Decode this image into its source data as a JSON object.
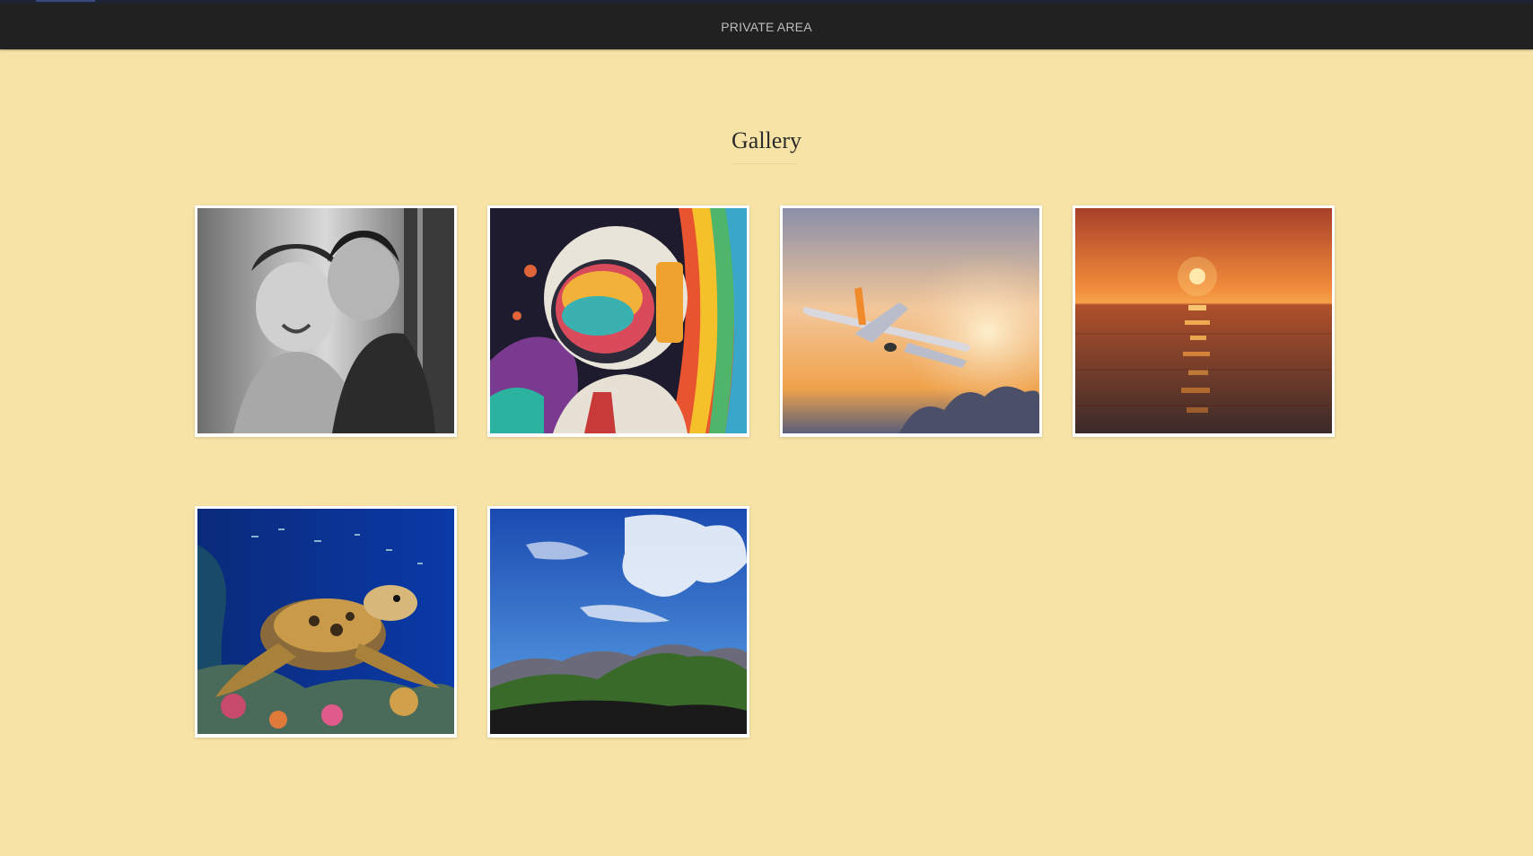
{
  "navbar": {
    "brand": "PRIVATE AREA"
  },
  "gallery": {
    "title": "Gallery",
    "items": [
      {
        "icon": "photo-children-bw"
      },
      {
        "icon": "photo-astronaut-art"
      },
      {
        "icon": "photo-airplane-sunset"
      },
      {
        "icon": "photo-sea-sunset"
      },
      {
        "icon": "photo-sea-turtle"
      },
      {
        "icon": "photo-mountain-sky"
      }
    ]
  },
  "colors": {
    "background": "#f7e3a5",
    "navbar": "#212121",
    "navbar_text": "#bdbdbd",
    "title_text": "#2b2b2b"
  }
}
